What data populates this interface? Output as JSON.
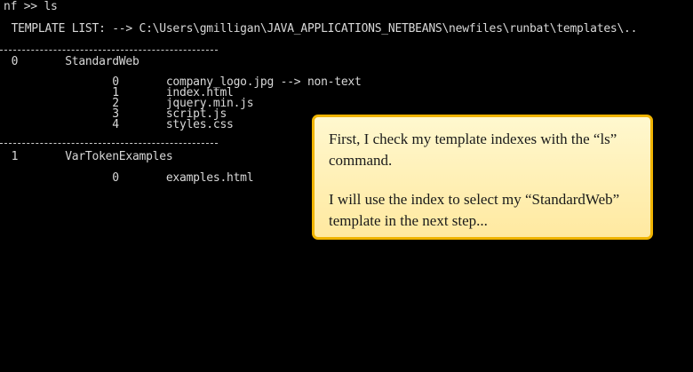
{
  "console": {
    "prompt_line": "nf >> ls",
    "template_list_header": " TEMPLATE LIST: --> C:\\Users\\gmilligan\\JAVA_APPLICATIONS_NETBEANS\\newfiles\\runbat\\templates\\..",
    "templates": [
      {
        "index_line": " 0       StandardWeb",
        "files": [
          "                0       company_logo.jpg --> non-text",
          "                1       index.html",
          "                2       jquery.min.js",
          "                3       script.js",
          "                4       styles.css"
        ]
      },
      {
        "index_line": " 1       VarTokenExamples",
        "files": [
          "                0       examples.html"
        ]
      }
    ]
  },
  "callout": {
    "paragraph_1": "First, I check my template indexes with the “ls” command.",
    "paragraph_2": "I will use the index to select my “StandardWeb” template in the next step..."
  },
  "colors": {
    "background": "#000000",
    "console_text": "#d8d8d8",
    "callout_fill": "#fff3bf",
    "callout_border": "#f0b400"
  }
}
